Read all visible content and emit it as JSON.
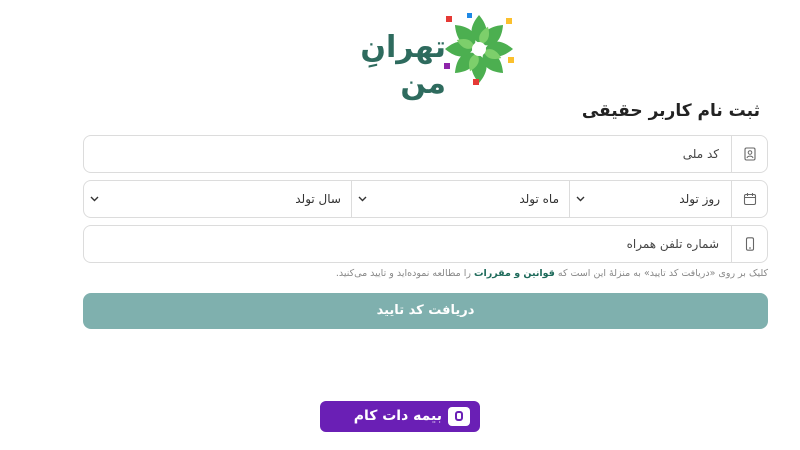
{
  "brand": {
    "logo_text": "تهرانِ من"
  },
  "form": {
    "title": "ثبت نام کاربر حقیقی",
    "national_code": {
      "placeholder": "کد ملی",
      "icon": "id-card-icon"
    },
    "birth_date": {
      "icon": "calendar-icon",
      "day": "روز تولد",
      "month": "ماه تولد",
      "year": "سال تولد"
    },
    "phone": {
      "placeholder": "شماره تلفن همراه",
      "icon": "mobile-phone-icon"
    },
    "notice_before": "کلیک بر روی «دریافت کد تایید» به منزلهٔ این است که ",
    "notice_link": "قوانین و مقررات",
    "notice_after": " را مطالعه نموده‌اید و تایید می‌کنید.",
    "submit_label": "دریافت کد تایید"
  },
  "footer": {
    "badge_text": "بیمه دات کام"
  },
  "colors": {
    "accent": "#7fb0ae",
    "link": "#1f6b5b",
    "badge": "#6a1fb5"
  }
}
